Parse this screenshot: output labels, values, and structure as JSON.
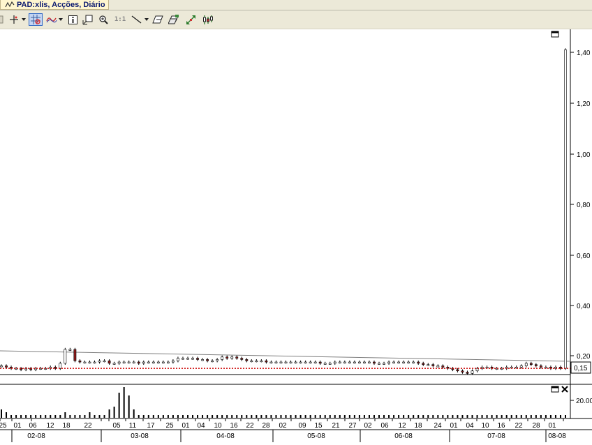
{
  "window": {
    "tab_title": "PAD:xlis, Acções, Diário"
  },
  "toolbar": {
    "buttons": [
      {
        "icon": "crosshair-icon"
      },
      {
        "icon": "dropdown-arrow-icon"
      },
      {
        "icon": "grid-toggle-icon",
        "active": true
      },
      {
        "icon": "indicator-wave-icon"
      },
      {
        "icon": "info-icon"
      },
      {
        "icon": "pan-icon"
      },
      {
        "icon": "zoom-icon"
      },
      {
        "icon": "zoom-reset-icon",
        "label": "1:1"
      },
      {
        "icon": "trendline-icon"
      },
      {
        "icon": "eraser-icon"
      },
      {
        "icon": "template-icon"
      },
      {
        "icon": "scale-icon"
      },
      {
        "icon": "candlestick-icon"
      }
    ]
  },
  "colors": {
    "up": "#ffffff",
    "down": "#8b1a1a",
    "stroke": "#000000",
    "last_price_line": "#cc0000",
    "trendline": "#7f7f7f"
  },
  "price_axis": {
    "ticks": [
      {
        "value": 1.4,
        "label": "1,40"
      },
      {
        "value": 1.2,
        "label": "1,20"
      },
      {
        "value": 1.0,
        "label": "1,00"
      },
      {
        "value": 0.8,
        "label": "0,80"
      },
      {
        "value": 0.6,
        "label": "0,60"
      },
      {
        "value": 0.4,
        "label": "0,40"
      },
      {
        "value": 0.2,
        "label": "0,20"
      }
    ],
    "last_price_label": "0,15",
    "last_price": 0.15
  },
  "volume_axis": {
    "label": "20.00"
  },
  "date_axis": {
    "day_labels": [
      "25",
      "01",
      "06",
      "12",
      "18",
      "22",
      "05",
      "11",
      "17",
      "25",
      "01",
      "04",
      "10",
      "16",
      "22",
      "28",
      "02",
      "09",
      "15",
      "21",
      "27",
      "02",
      "06",
      "12",
      "18",
      "24",
      "01",
      "04",
      "10",
      "16",
      "22",
      "28",
      "01"
    ],
    "month_labels": [
      "02-08",
      "03-08",
      "04-08",
      "05-08",
      "06-08",
      "07-08",
      "08-08"
    ]
  },
  "chart_data": {
    "type": "candlestick",
    "x_categories": [
      "25",
      "01",
      "06",
      "12",
      "18",
      "22",
      "05",
      "11",
      "17",
      "25",
      "01",
      "04",
      "10",
      "16",
      "22",
      "28",
      "02",
      "09",
      "15",
      "21",
      "27",
      "02",
      "06",
      "12",
      "18",
      "24",
      "01",
      "04",
      "10",
      "16",
      "22",
      "28",
      "01"
    ],
    "ylim": [
      0.1,
      1.48
    ],
    "price_closes": [
      0.16,
      0.155,
      0.15,
      0.15,
      0.145,
      0.15,
      0.145,
      0.15,
      0.15,
      0.15,
      0.155,
      0.15,
      0.17,
      0.225,
      0.225,
      0.18,
      0.175,
      0.175,
      0.175,
      0.175,
      0.18,
      0.18,
      0.17,
      0.17,
      0.175,
      0.175,
      0.175,
      0.175,
      0.17,
      0.175,
      0.175,
      0.175,
      0.175,
      0.175,
      0.175,
      0.18,
      0.19,
      0.19,
      0.19,
      0.19,
      0.185,
      0.185,
      0.18,
      0.18,
      0.185,
      0.195,
      0.19,
      0.195,
      0.19,
      0.185,
      0.18,
      0.18,
      0.18,
      0.18,
      0.175,
      0.175,
      0.175,
      0.175,
      0.175,
      0.175,
      0.175,
      0.175,
      0.175,
      0.175,
      0.175,
      0.17,
      0.17,
      0.17,
      0.175,
      0.175,
      0.175,
      0.175,
      0.175,
      0.175,
      0.175,
      0.175,
      0.17,
      0.17,
      0.17,
      0.175,
      0.175,
      0.175,
      0.175,
      0.175,
      0.175,
      0.17,
      0.165,
      0.165,
      0.16,
      0.16,
      0.155,
      0.15,
      0.145,
      0.14,
      0.135,
      0.13,
      0.14,
      0.15,
      0.155,
      0.155,
      0.15,
      0.15,
      0.15,
      0.155,
      0.155,
      0.155,
      0.16,
      0.17,
      0.165,
      0.16,
      0.155,
      0.155,
      0.15,
      0.155,
      0.15,
      1.41
    ],
    "volume_values": [
      3,
      2,
      1,
      1,
      1,
      1,
      1,
      1,
      1,
      1,
      1,
      1,
      1,
      2,
      1,
      1,
      1,
      1,
      2,
      1,
      1,
      1,
      3,
      4,
      9,
      11,
      8,
      3,
      1,
      1,
      1,
      1,
      1,
      1,
      1,
      1,
      1,
      1,
      1,
      1,
      1,
      1,
      1,
      1,
      1,
      1,
      1,
      1,
      1,
      1,
      1,
      1,
      1,
      1,
      1,
      1,
      1,
      1,
      1,
      1,
      1,
      1,
      1,
      1,
      1,
      1,
      1,
      1,
      1,
      1,
      1,
      1,
      1,
      1,
      1,
      1,
      1,
      1,
      1,
      1,
      1,
      1,
      1,
      1,
      1,
      1,
      1,
      1,
      1,
      1,
      1,
      1,
      1,
      1,
      1,
      1,
      1,
      1,
      1,
      1,
      1,
      1,
      1,
      1,
      1,
      1,
      1,
      1,
      1,
      1,
      1,
      1,
      1,
      1,
      1,
      1
    ]
  }
}
